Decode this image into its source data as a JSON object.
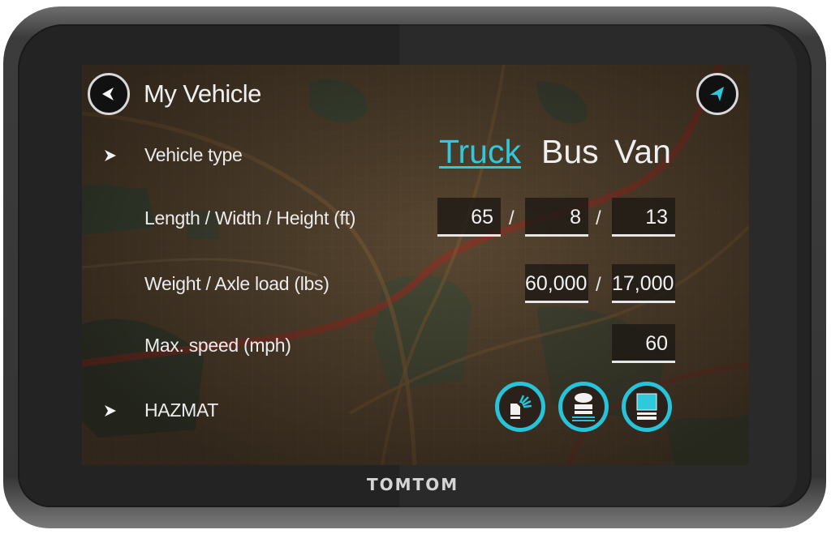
{
  "device": {
    "brand": "TOMTOM"
  },
  "header": {
    "title": "My Vehicle",
    "back_icon": "back-arrow-icon",
    "nav_icon": "navigation-arrow-icon"
  },
  "vehicle_type": {
    "label": "Vehicle type",
    "options": [
      "Truck",
      "Bus",
      "Van"
    ],
    "selected": "Truck"
  },
  "dimensions": {
    "label": "Length / Width / Height (ft)",
    "length": "65",
    "width": "8",
    "height": "13",
    "separator": "/"
  },
  "weight": {
    "label": "Weight / Axle load (lbs)",
    "weight": "60,000",
    "axle_load": "17,000",
    "separator": "/"
  },
  "speed": {
    "label": "Max. speed (mph)",
    "value": "60"
  },
  "hazmat": {
    "label": "HAZMAT",
    "icons": [
      "hazmat-explosive-icon",
      "hazmat-water-pollutant-icon",
      "hazmat-general-cargo-icon"
    ]
  },
  "colors": {
    "accent": "#2fc9de",
    "text": "#f0f0f0",
    "bezel": "#232323"
  }
}
